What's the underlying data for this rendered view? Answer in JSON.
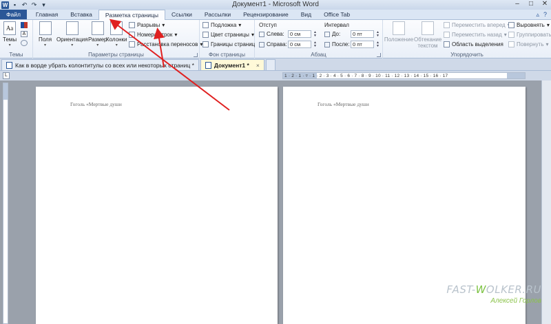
{
  "window": {
    "title": "Документ1 - Microsoft Word",
    "controls": [
      "minimize",
      "maximize",
      "close"
    ]
  },
  "quick_access": {
    "icons": [
      "word-logo-icon",
      "save-icon",
      "undo-icon",
      "redo-icon",
      "customize-icon"
    ],
    "logo_letter": "W",
    "undo_glyph": "↶",
    "redo_glyph": "↷",
    "save_glyph": "▪",
    "more_glyph": "▾"
  },
  "tabs": {
    "file": "Файл",
    "items": [
      "Главная",
      "Вставка",
      "Разметка страницы",
      "Ссылки",
      "Рассылки",
      "Рецензирование",
      "Вид",
      "Office Tab"
    ],
    "active_index": 2,
    "right_icons": [
      "▵",
      "?"
    ]
  },
  "ribbon": {
    "themes": {
      "label": "Темы",
      "button": "Темы"
    },
    "page_setup": {
      "label": "Параметры страницы",
      "margins": "Поля",
      "orientation": "Ориентация",
      "size": "Размер",
      "columns": "Колонки",
      "breaks": "Разрывы",
      "line_numbers": "Номера строк",
      "hyphenation": "Расстановка переносов"
    },
    "page_background": {
      "label": "Фон страницы",
      "watermark": "Подложка",
      "page_color": "Цвет страницы",
      "page_borders": "Границы страниц"
    },
    "paragraph": {
      "label": "Абзац",
      "indent_title": "Отступ",
      "left_label": "Слева:",
      "left_value": "0 см",
      "right_label": "Справа:",
      "right_value": "0 см",
      "spacing_title": "Интервал",
      "before_label": "До:",
      "before_value": "0 пт",
      "after_label": "После:",
      "after_value": "0 пт"
    },
    "arrange": {
      "label": "Упорядочить",
      "position": "Положение",
      "wrap_text": "Обтекание текстом",
      "bring_forward": "Переместить вперед",
      "send_backward": "Переместить назад",
      "selection_pane": "Область выделения",
      "align": "Выровнять",
      "group": "Группировать",
      "rotate": "Повернуть"
    }
  },
  "doc_tabs": [
    {
      "label": "Как в ворде убрать колонтитулы со всех или некоторых страниц *",
      "active": false
    },
    {
      "label": "Документ1 *",
      "active": true
    }
  ],
  "doc_tab_close": "×",
  "ruler": {
    "corner": "L",
    "numbers": "1 · 2 · 1 · ▿ · 1 · 2 · 3 · 4 · 5 · 6 · 7 · 8 · 9 · 10 · 11 · 12 · 13 · 14 · 15 · 16 · 17"
  },
  "pages": [
    {
      "header": "Гоголь «Мертвые души"
    },
    {
      "header": "Гоголь «Мертвые души"
    }
  ],
  "watermark": {
    "site_prefix": "FAST-",
    "site_w": "W",
    "site_suffix": "OLKER.RU",
    "author": "Алексей Горлов"
  },
  "annotation_color": "#e02020"
}
